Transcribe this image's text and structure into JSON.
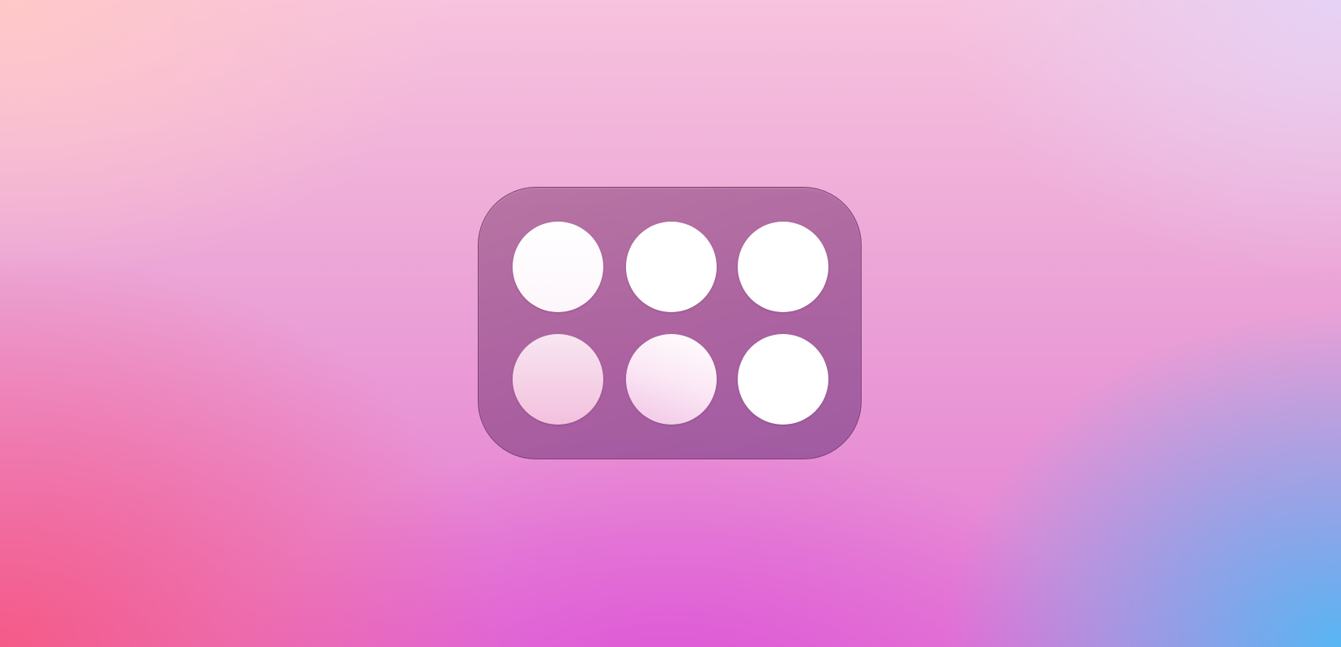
{
  "background": {
    "colors": [
      "#fdc4c8",
      "#f6a9d8",
      "#e27bd6",
      "#f77a8c",
      "#5bbcf2"
    ]
  },
  "widget": {
    "panel_color": "#8e4d80",
    "dot_color": "#ffffff",
    "dots": [
      {
        "name": "dot-1",
        "state": "filled"
      },
      {
        "name": "dot-2",
        "state": "filled"
      },
      {
        "name": "dot-3",
        "state": "filled"
      },
      {
        "name": "dot-4",
        "state": "tinted"
      },
      {
        "name": "dot-5",
        "state": "tinted"
      },
      {
        "name": "dot-6",
        "state": "filled"
      }
    ]
  }
}
